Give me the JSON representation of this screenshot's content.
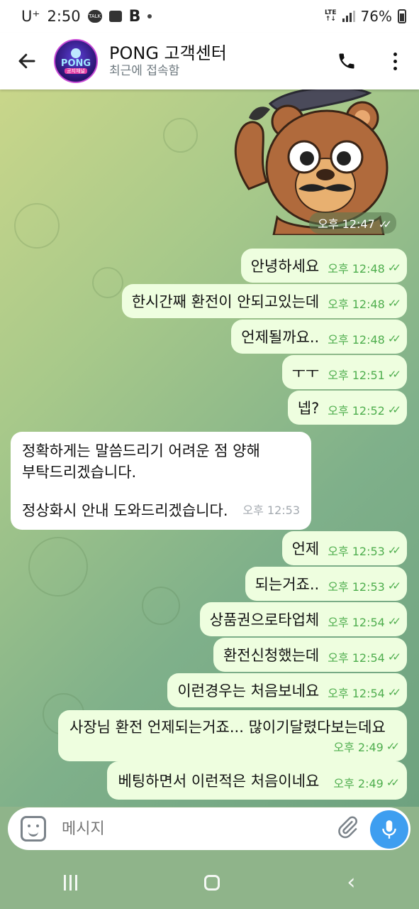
{
  "status_bar": {
    "carrier": "U⁺",
    "time": "2:50",
    "talk_badge": "TALK",
    "network": "LTE",
    "battery": "76%"
  },
  "header": {
    "title": "PONG 고객센터",
    "subtitle": "최근에 접속함",
    "avatar_logo": "PONG",
    "avatar_sub": "공지채널"
  },
  "sticker": {
    "time": "오후 12:47"
  },
  "messages": [
    {
      "dir": "out",
      "text": "안녕하세요",
      "time": "오후 12:48"
    },
    {
      "dir": "out",
      "text": "한시간째 환전이 안되고있는데",
      "time": "오후 12:48"
    },
    {
      "dir": "out",
      "text": "언제될까요..",
      "time": "오후 12:48"
    },
    {
      "dir": "out",
      "text": "ㅜㅜ",
      "time": "오후 12:51"
    },
    {
      "dir": "out",
      "text": "넵?",
      "time": "오후 12:52"
    },
    {
      "dir": "in",
      "line1": "정확하게는 말씀드리기 어려운 점 양해",
      "line2": "부탁드리겠습니다.",
      "line3": "정상화시 안내 도와드리겠습니다.",
      "time": "오후 12:53"
    },
    {
      "dir": "out",
      "text": "언제",
      "time": "오후 12:53"
    },
    {
      "dir": "out",
      "text": "되는거죠..",
      "time": "오후 12:53"
    },
    {
      "dir": "out",
      "text": "상품권으로타업체",
      "time": "오후 12:54"
    },
    {
      "dir": "out",
      "text": "환전신청했는데",
      "time": "오후 12:54"
    },
    {
      "dir": "out",
      "text": "이런경우는 처음보네요",
      "time": "오후 12:54"
    },
    {
      "dir": "out",
      "text": "사장님 환전 언제되는거죠... 많이기달렸다보는데요",
      "time": "오후 2:49"
    },
    {
      "dir": "out",
      "text": "베팅하면서 이런적은 처음이네요",
      "time": "오후 2:49"
    }
  ],
  "input": {
    "placeholder": "메시지"
  }
}
